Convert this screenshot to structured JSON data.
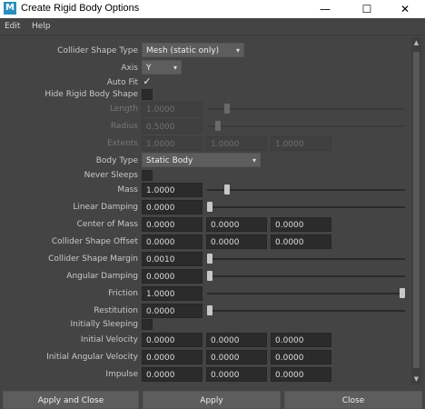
{
  "window": {
    "title": "Create Rigid Body Options",
    "app_icon_letter": "M",
    "controls": {
      "minimize": "—",
      "maximize": "☐",
      "close": "✕"
    }
  },
  "menu": {
    "items": [
      "Edit",
      "Help"
    ]
  },
  "form": {
    "collider_shape_type": {
      "label": "Collider Shape Type",
      "value": "Mesh (static only)"
    },
    "axis": {
      "label": "Axis",
      "value": "Y"
    },
    "auto_fit": {
      "label": "Auto Fit",
      "checked": true,
      "mark": "✓"
    },
    "hide_rigid_body_shape": {
      "label": "Hide Rigid Body Shape",
      "checked": false
    },
    "length": {
      "label": "Length",
      "value": "1.0000",
      "slider_fraction": 0.3
    },
    "radius": {
      "label": "Radius",
      "value": "0.5000",
      "slider_fraction": 0.1
    },
    "extents": {
      "label": "Extents",
      "values": [
        "1.0000",
        "1.0000",
        "1.0000"
      ]
    },
    "body_type": {
      "label": "Body Type",
      "value": "Static Body"
    },
    "never_sleeps": {
      "label": "Never Sleeps",
      "checked": false
    },
    "mass": {
      "label": "Mass",
      "value": "1.0000",
      "slider_fraction": 0.1
    },
    "linear_damping": {
      "label": "Linear Damping",
      "value": "0.0000",
      "slider_fraction": 0.0
    },
    "center_of_mass": {
      "label": "Center of Mass",
      "values": [
        "0.0000",
        "0.0000",
        "0.0000"
      ]
    },
    "collider_shape_offset": {
      "label": "Collider Shape Offset",
      "values": [
        "0.0000",
        "0.0000",
        "0.0000"
      ]
    },
    "collider_shape_margin": {
      "label": "Collider Shape Margin",
      "value": "0.0010",
      "slider_fraction": 0.0
    },
    "angular_damping": {
      "label": "Angular Damping",
      "value": "0.0000",
      "slider_fraction": 0.0
    },
    "friction": {
      "label": "Friction",
      "value": "1.0000",
      "slider_fraction": 1.0
    },
    "restitution": {
      "label": "Restitution",
      "value": "0.0000",
      "slider_fraction": 0.0
    },
    "initially_sleeping": {
      "label": "Initially Sleeping",
      "checked": false
    },
    "initial_velocity": {
      "label": "Initial Velocity",
      "values": [
        "0.0000",
        "0.0000",
        "0.0000"
      ]
    },
    "initial_angular_velocity": {
      "label": "Initial Angular Velocity",
      "values": [
        "0.0000",
        "0.0000",
        "0.0000"
      ]
    },
    "impulse": {
      "label": "Impulse",
      "values": [
        "0.0000",
        "0.0000",
        "0.0000"
      ]
    }
  },
  "buttons": {
    "apply_and_close": "Apply and Close",
    "apply": "Apply",
    "close": "Close"
  },
  "icons": {
    "dropdown_arrow": "▾",
    "scroll_up": "▲",
    "scroll_down": "▼"
  },
  "colors": {
    "background": "#444444",
    "field": "#2b2b2b",
    "button": "#5d5d5d",
    "app_icon": "#2b8fbd"
  }
}
